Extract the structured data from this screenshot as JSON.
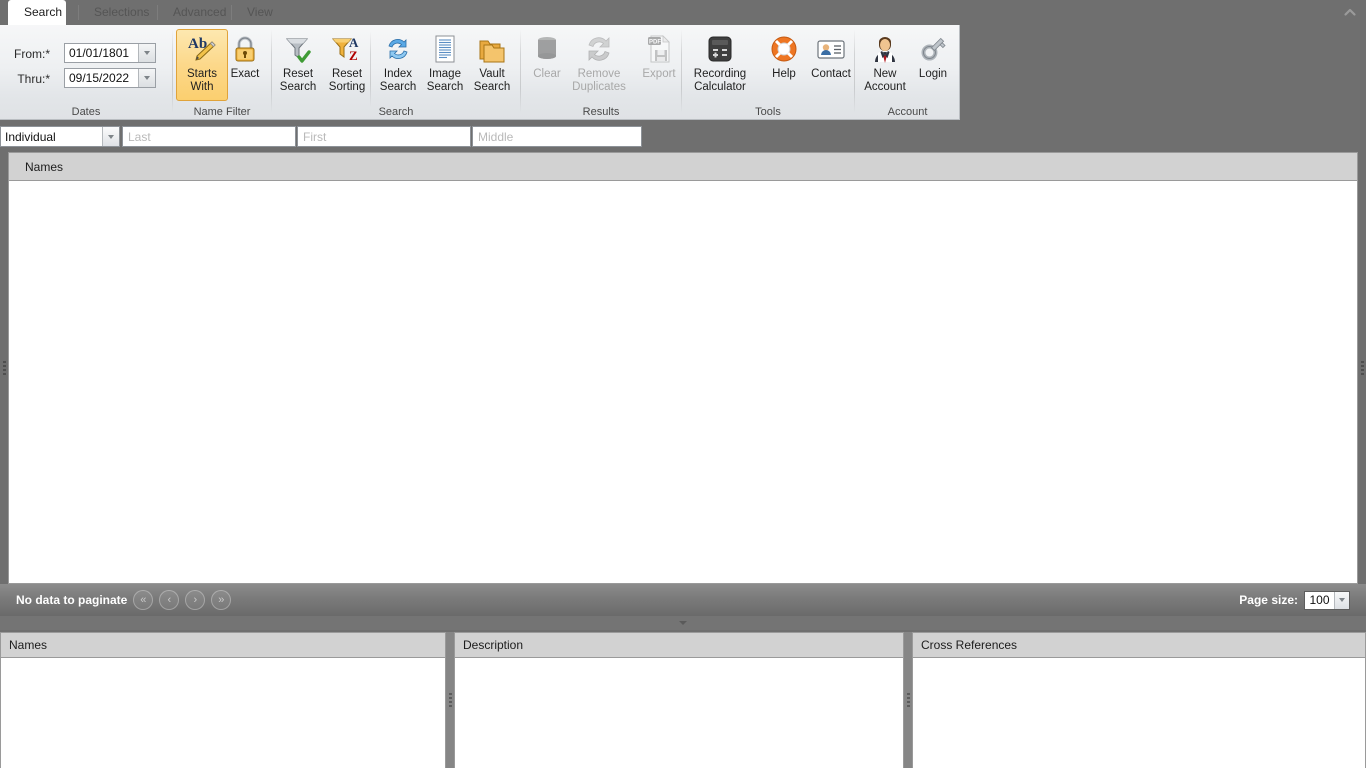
{
  "window": {
    "title": "Search",
    "ribbon_collapse_icon": "chevron-up-icon"
  },
  "tabs": [
    {
      "label": "Search",
      "active": true
    },
    {
      "label": "Selections",
      "active": false
    },
    {
      "label": "Advanced",
      "active": false
    },
    {
      "label": "View",
      "active": false
    }
  ],
  "ribbon": {
    "groups": [
      {
        "name": "dates",
        "label": "Dates"
      },
      {
        "name": "name-filter",
        "label": "Name Filter"
      },
      {
        "name": "search",
        "label": "Search"
      },
      {
        "name": "results",
        "label": "Results"
      },
      {
        "name": "tools",
        "label": "Tools"
      },
      {
        "name": "account",
        "label": "Account"
      }
    ],
    "dates": {
      "from_label": "From:*",
      "from_value": "01/01/1801",
      "thru_label": "Thru:*",
      "thru_value": "09/15/2022"
    },
    "buttons": [
      {
        "name": "starts-with",
        "label": "Starts\nWith",
        "line1": "Starts",
        "line2": "With",
        "icon": "ab-pencil-icon",
        "state": "selected"
      },
      {
        "name": "exact",
        "label": "Exact",
        "line1": "Exact",
        "line2": "",
        "icon": "lock-icon",
        "state": "normal"
      },
      {
        "name": "reset-search",
        "label": "Reset Search",
        "line1": "Reset",
        "line2": "Search",
        "icon": "funnel-check-icon",
        "state": "normal"
      },
      {
        "name": "reset-sorting",
        "label": "Reset Sorting",
        "line1": "Reset",
        "line2": "Sorting",
        "icon": "funnel-az-icon",
        "state": "normal"
      },
      {
        "name": "index-search",
        "label": "Index Search",
        "line1": "Index",
        "line2": "Search",
        "icon": "refresh-arrows-icon",
        "state": "normal"
      },
      {
        "name": "image-search",
        "label": "Image Search",
        "line1": "Image",
        "line2": "Search",
        "icon": "document-lines-icon",
        "state": "normal"
      },
      {
        "name": "vault-search",
        "label": "Vault Search",
        "line1": "Vault",
        "line2": "Search",
        "icon": "folders-icon",
        "state": "normal"
      },
      {
        "name": "clear",
        "label": "Clear",
        "line1": "Clear",
        "line2": "",
        "icon": "trash-can-icon",
        "state": "disabled"
      },
      {
        "name": "remove-duplicates",
        "label": "Remove Duplicates",
        "line1": "Remove",
        "line2": "Duplicates",
        "icon": "recycle-arrows-icon",
        "state": "disabled"
      },
      {
        "name": "export",
        "label": "Export",
        "line1": "Export",
        "line2": "",
        "icon": "pdf-export-icon",
        "state": "disabled"
      },
      {
        "name": "recording-calculator",
        "label": "Recording Calculator",
        "line1": "Recording",
        "line2": "Calculator",
        "icon": "calculator-icon",
        "state": "normal"
      },
      {
        "name": "help",
        "label": "Help",
        "line1": "Help",
        "line2": "",
        "icon": "life-ring-icon",
        "state": "normal"
      },
      {
        "name": "contact",
        "label": "Contact",
        "line1": "Contact",
        "line2": "",
        "icon": "contact-card-icon",
        "state": "normal"
      },
      {
        "name": "new-account",
        "label": "New Account",
        "line1": "New",
        "line2": "Account",
        "icon": "person-suit-icon",
        "state": "normal"
      },
      {
        "name": "login",
        "label": "Login",
        "line1": "Login",
        "line2": "",
        "icon": "key-icon",
        "state": "normal"
      }
    ]
  },
  "search_row": {
    "type_selected": "Individual",
    "type_options": [
      "Individual"
    ],
    "last_placeholder": "Last",
    "last_value": "",
    "first_placeholder": "First",
    "first_value": "",
    "middle_placeholder": "Middle",
    "middle_value": ""
  },
  "grid": {
    "header": "Names",
    "rows": []
  },
  "pager": {
    "status": "No data to paginate",
    "first_icon": "«",
    "prev_icon": "‹",
    "next_icon": "›",
    "last_icon": "»",
    "page_size_label": "Page size:",
    "page_size_value": "100"
  },
  "bottom_panels": [
    {
      "name": "names-panel",
      "title": "Names",
      "content": ""
    },
    {
      "name": "description-panel",
      "title": "Description",
      "content": ""
    },
    {
      "name": "cross-references-panel",
      "title": "Cross References",
      "content": ""
    }
  ],
  "colors": {
    "chrome": "#6f6f6f",
    "ribbon_bg": "#eef0f2",
    "selected_button": "#fcd88a",
    "grid_header": "#d2d2d2",
    "pager_bg": "#7c7c7c"
  }
}
